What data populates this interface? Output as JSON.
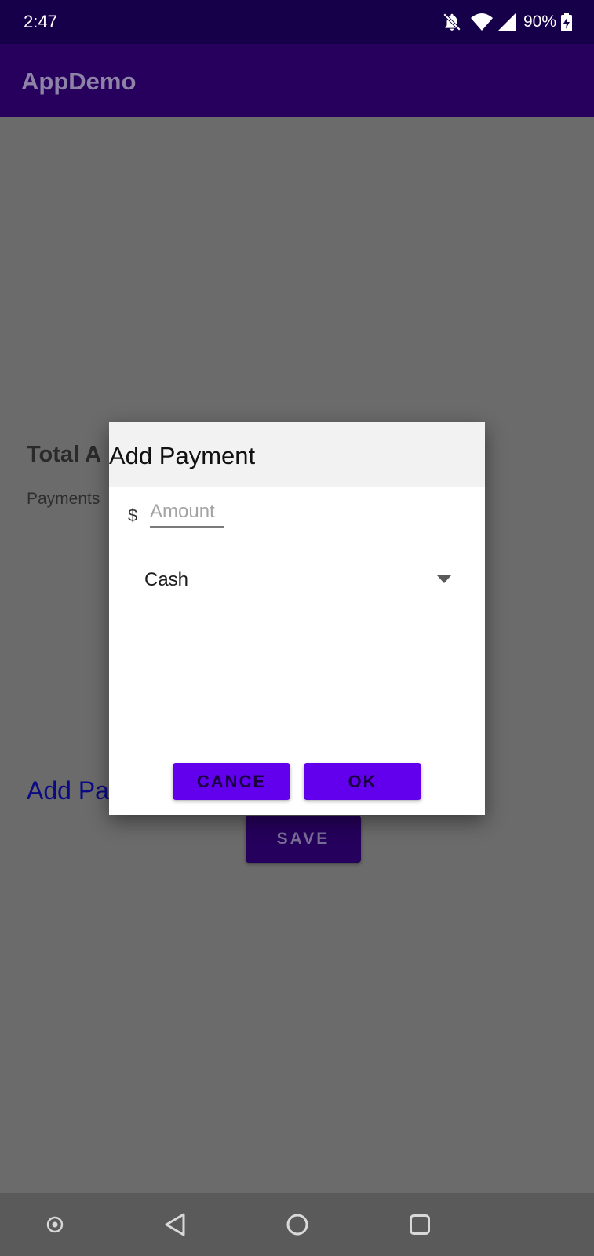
{
  "status_bar": {
    "time": "2:47",
    "battery": "90%",
    "icons": [
      "notifications-off-icon",
      "wifi-icon",
      "cell-signal-icon",
      "battery-charging-icon"
    ]
  },
  "app_bar": {
    "title": "AppDemo"
  },
  "main": {
    "total_label": "Total A",
    "payments_label": "Payments",
    "add_payment_link": "Add Pa",
    "save_button": "SAVE"
  },
  "dialog": {
    "title": "Add Payment",
    "currency_symbol": "$",
    "amount_placeholder": "Amount",
    "payment_method_selected": "Cash",
    "cancel_button": "CANCE",
    "ok_button": "OK"
  },
  "nav_bar": {
    "icons": [
      "accessibility-dot-icon",
      "back-icon",
      "home-icon",
      "recents-icon"
    ]
  },
  "colors": {
    "status_bar": "#16004a",
    "app_bar": "#26005c",
    "accent": "#6200ee",
    "scrim": "#6b6b6b"
  }
}
